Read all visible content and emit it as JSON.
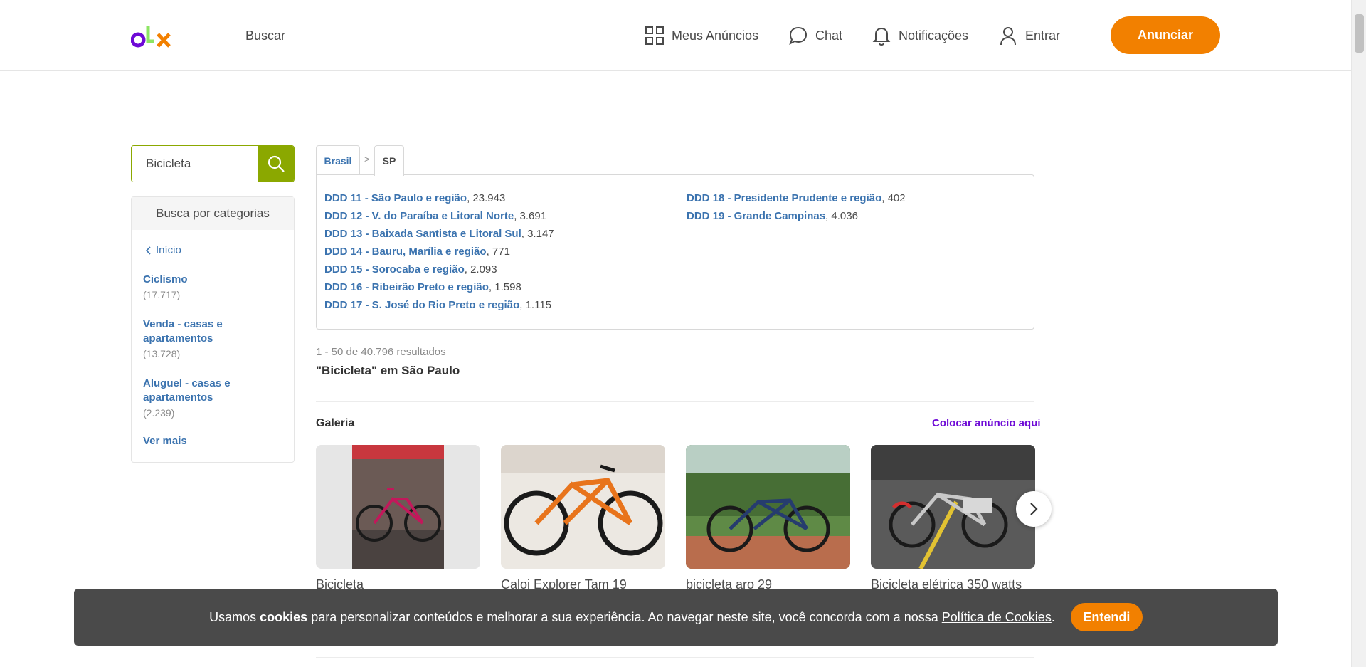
{
  "header": {
    "buscar": "Buscar",
    "nav": {
      "meus_anuncios": "Meus Anúncios",
      "chat": "Chat",
      "notificacoes": "Notificações",
      "entrar": "Entrar"
    },
    "anunciar": "Anunciar"
  },
  "search": {
    "value": "Bicicleta"
  },
  "categories": {
    "heading": "Busca por categorias",
    "inicio": "Início",
    "items": [
      {
        "label_lines": [
          "Ciclismo"
        ],
        "count": "(17.717)"
      },
      {
        "label_lines": [
          "Venda - casas e",
          "apartamentos"
        ],
        "count": "(13.728)"
      },
      {
        "label_lines": [
          "Aluguel - casas e",
          "apartamentos"
        ],
        "count": "(2.239)"
      }
    ],
    "ver_mais": "Ver mais"
  },
  "location": {
    "tabs": [
      "Brasil",
      "SP"
    ],
    "separator": ">",
    "regions": [
      {
        "name": "DDD 11 - São Paulo e região",
        "count": "23.943"
      },
      {
        "name": "DDD 12 - V. do Paraíba e Litoral Norte",
        "count": "3.691"
      },
      {
        "name": "DDD 13 - Baixada Santista e Litoral Sul",
        "count": "3.147"
      },
      {
        "name": "DDD 14 - Bauru, Marília e região",
        "count": "771"
      },
      {
        "name": "DDD 15 - Sorocaba e região",
        "count": "2.093"
      },
      {
        "name": "DDD 16 - Ribeirão Preto e região",
        "count": "1.598"
      },
      {
        "name": "DDD 17 - S. José do Rio Preto e região",
        "count": "1.115"
      },
      {
        "name": "DDD 18 - Presidente Prudente e região",
        "count": "402"
      },
      {
        "name": "DDD 19 - Grande Campinas",
        "count": "4.036"
      }
    ]
  },
  "results": {
    "count_text": "1 - 50 de 40.796 resultados",
    "title": "\"Bicicleta\" em São Paulo"
  },
  "gallery": {
    "heading": "Galeria",
    "cta": "Colocar anúncio aqui",
    "items": [
      {
        "title": "Bicicleta"
      },
      {
        "title": "Caloi Explorer Tam 19"
      },
      {
        "title": "bicicleta aro 29"
      },
      {
        "title": "Bicicleta elétrica 350 watts"
      }
    ]
  },
  "cookie": {
    "text_before": "Usamos ",
    "bold": "cookies",
    "text_middle": " para personalizar conteúdos e melhorar a sua experiência. Ao navegar neste site, você concorda com a nossa ",
    "link": "Política de Cookies",
    "text_after": ".",
    "button": "Entendi"
  },
  "colors": {
    "brand_orange": "#f28000",
    "brand_green": "#8ba800",
    "brand_purple": "#6e0ad6",
    "link_blue": "#3b73af"
  }
}
